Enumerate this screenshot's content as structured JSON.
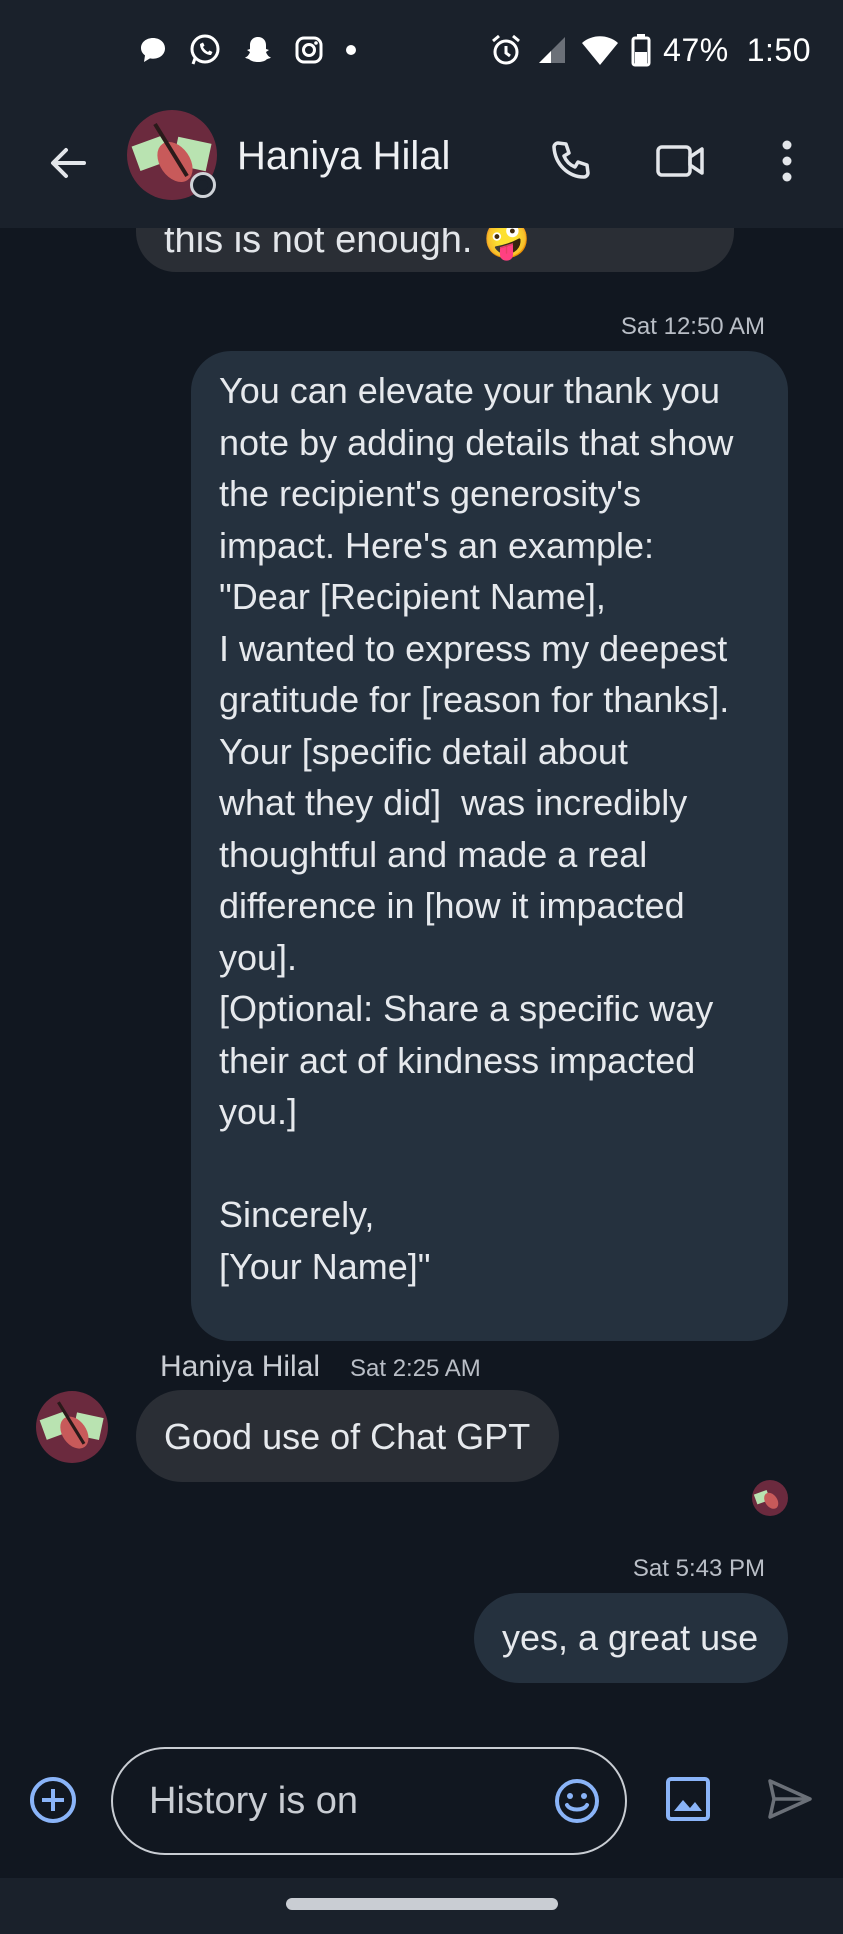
{
  "status_bar": {
    "left_icons": [
      "chat-bubble-icon",
      "whatsapp-icon",
      "snapchat-icon",
      "instagram-icon",
      "dot-icon"
    ],
    "right_icons": [
      "alarm-icon",
      "signal-icon",
      "wifi-icon",
      "battery-icon"
    ],
    "battery": "47%",
    "time": "1:50"
  },
  "header": {
    "contact_name": "Haniya Hilal",
    "icons": [
      "back-arrow-icon",
      "phone-icon",
      "video-icon",
      "more-vert-icon"
    ]
  },
  "messages": {
    "prev_partial": "this is not enough. 🤪",
    "m1": {
      "timestamp": "Sat 12:50 AM",
      "text": "You can elevate your thank you\nnote by adding details that show\nthe recipient's generosity's\nimpact. Here's an example:\n\"Dear [Recipient Name],\nI wanted to express my deepest\ngratitude for [reason for thanks].\nYour [specific detail about\nwhat they did]  was incredibly\nthoughtful and made a real\ndifference in [how it impacted\nyou].\n[Optional: Share a specific way\ntheir act of kindness impacted\nyou.]\n\nSincerely,\n[Your Name]\""
    },
    "m2": {
      "sender": "Haniya Hilal",
      "timestamp": "Sat 2:25 AM",
      "text": "Good use of Chat GPT"
    },
    "m3": {
      "timestamp": "Sat 5:43 PM",
      "text": "yes, a great use"
    }
  },
  "compose": {
    "placeholder": "History is on",
    "icons": [
      "add-circle-icon",
      "emoji-icon",
      "image-icon",
      "send-icon"
    ]
  },
  "colors": {
    "background": "#111720",
    "bar": "#1a212b",
    "outgoing_bubble": "#25313e",
    "incoming_bubble": "#2a2e35",
    "accent": "#8ab4f8"
  }
}
